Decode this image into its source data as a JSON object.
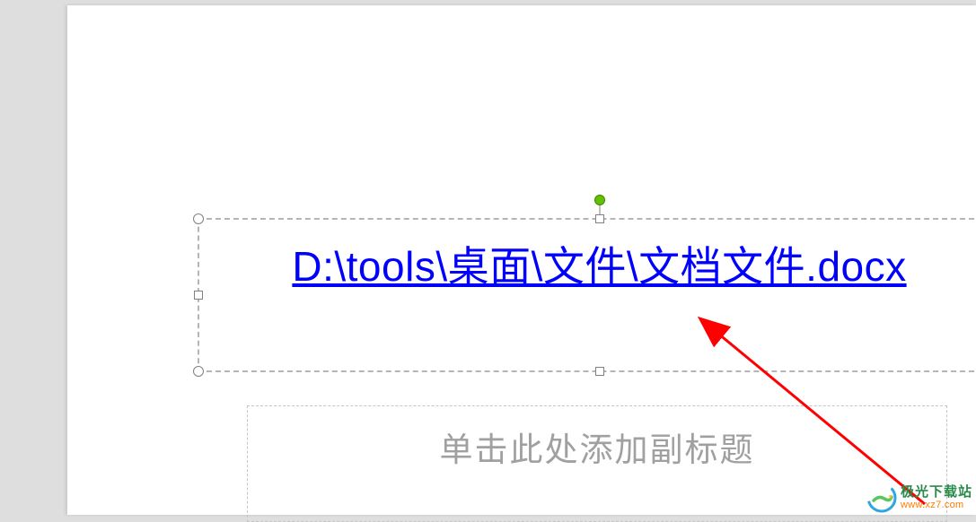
{
  "slide": {
    "title_link_text": "D:\\tools\\桌面\\文件\\文档文件.docx",
    "subtitle_placeholder": "单击此处添加副标题"
  },
  "watermark": {
    "title": "极光下载站",
    "url": "www.xz7.com"
  },
  "colors": {
    "link": "#0000ff",
    "placeholder": "#a0a0a0",
    "arrow": "#ff0000",
    "rotation_handle": "#62c000"
  }
}
